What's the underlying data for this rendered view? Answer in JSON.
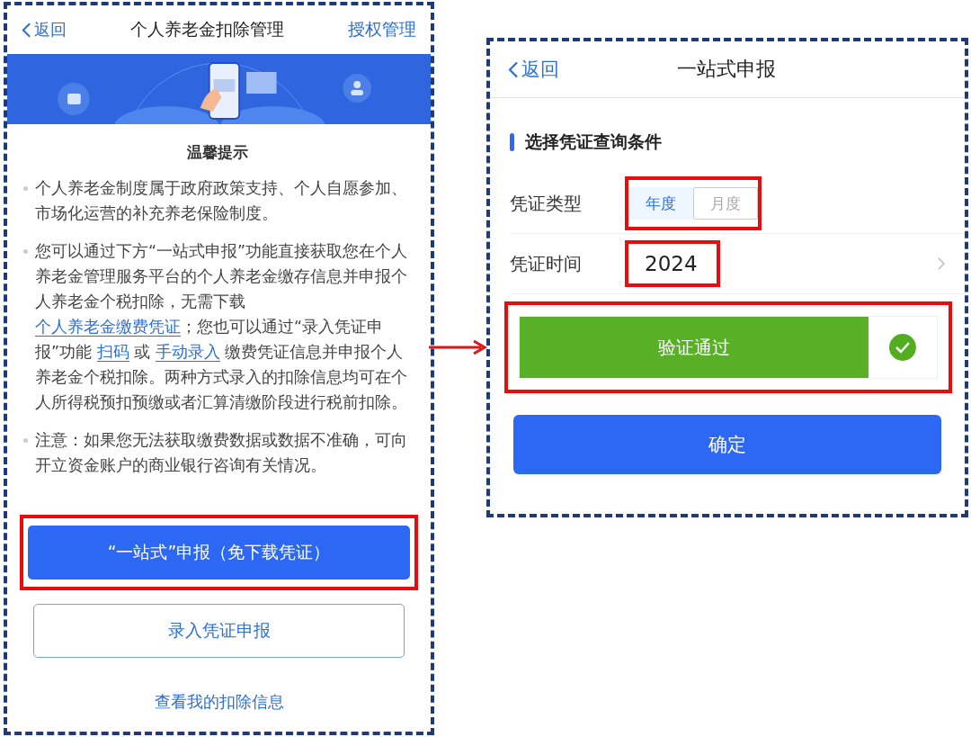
{
  "left_screen": {
    "back": "返回",
    "title": "个人养老金扣除管理",
    "action": "授权管理",
    "notice_title": "温馨提示",
    "paragraphs": [
      [
        {
          "kind": "text",
          "text": "个人养老金制度属于政府政策支持、个人自愿参加、市场化运营的补充养老保险制度。"
        }
      ],
      [
        {
          "kind": "text",
          "text": "您可以通过下方“一站式申报”功能直接获取您在个人养老金管理服务平台的个人养老金缴存信息并申报个人养老金个税扣除，无需下载 "
        },
        {
          "kind": "link",
          "text": "个人养老金缴费凭证"
        },
        {
          "kind": "text",
          "text": "；您也可以通过“录入凭证申报”功能 "
        },
        {
          "kind": "link",
          "text": "扫码"
        },
        {
          "kind": "text",
          "text": " 或 "
        },
        {
          "kind": "link",
          "text": "手动录入"
        },
        {
          "kind": "text",
          "text": " 缴费凭证信息并申报个人养老金个税扣除。两种方式录入的扣除信息均可在个人所得税预扣预缴或者汇算清缴阶段进行税前扣除。"
        }
      ],
      [
        {
          "kind": "text",
          "text": "注意：如果您无法获取缴费数据或数据不准确，可向开立资金账户的商业银行咨询有关情况。"
        }
      ]
    ],
    "buttons": [
      {
        "kind": "primary",
        "label": "“一站式”申报（免下载凭证）",
        "highlighted": true
      },
      {
        "kind": "outline",
        "label": "录入凭证申报",
        "highlighted": false
      },
      {
        "kind": "link",
        "label": "查看我的扣除信息",
        "highlighted": false
      }
    ]
  },
  "right_screen": {
    "back": "返回",
    "title": "一站式申报",
    "section_title": "选择凭证查询条件",
    "type_row": {
      "label": "凭证类型",
      "highlighted": true,
      "options": [
        {
          "label": "年度",
          "selected": true
        },
        {
          "label": "月度",
          "selected": false
        }
      ]
    },
    "time_row": {
      "label": "凭证时间",
      "value": "2024",
      "highlighted": true
    },
    "verify": {
      "label": "验证通过",
      "verified": true,
      "highlighted": true
    },
    "confirm": "确定"
  }
}
